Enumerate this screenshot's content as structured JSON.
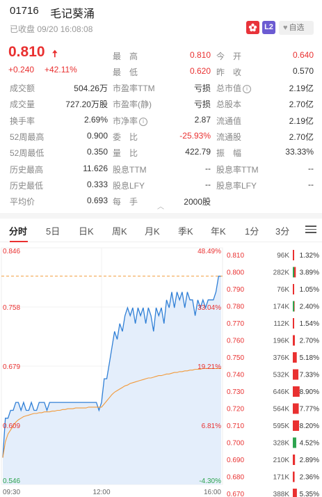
{
  "header": {
    "code": "01716",
    "name": "毛记葵涌",
    "status": "已收盘 09/20 16:08:08",
    "badge_lv": "L2",
    "favorite_label": "自选"
  },
  "quote": {
    "price": "0.810",
    "change": "+0.240",
    "change_pct": "+42.11%",
    "right_rows": [
      {
        "l1": "最　高",
        "v1": "0.810",
        "l2": "今　开",
        "v2": "0.640"
      },
      {
        "l1": "最　低",
        "v1": "0.620",
        "l2": "昨　收",
        "v2": "0.570"
      }
    ],
    "rows": [
      {
        "l1": "成交额",
        "v1": "504.26万",
        "l2": "市盈率TTM",
        "v2": "亏损",
        "l3": "总市值",
        "v3": "2.19亿"
      },
      {
        "l1": "成交量",
        "v1": "727.20万股",
        "l2": "市盈率(静)",
        "v2": "亏损",
        "l3": "总股本",
        "v3": "2.70亿"
      },
      {
        "l1": "换手率",
        "v1": "2.69%",
        "l2": "市净率",
        "v2": "2.87",
        "l3": "流通值",
        "v3": "2.19亿"
      },
      {
        "l1": "52周最高",
        "v1": "0.900",
        "l2": "委　比",
        "v2": "-25.93%",
        "l3": "流通股",
        "v3": "2.70亿"
      },
      {
        "l1": "52周最低",
        "v1": "0.350",
        "l2": "量　比",
        "v2": "422.79",
        "l3": "振　幅",
        "v3": "33.33%"
      },
      {
        "l1": "历史最高",
        "v1": "11.626",
        "l2": "股息TTM",
        "v2": "--",
        "l3": "股息率TTM",
        "v3": "--"
      },
      {
        "l1": "历史最低",
        "v1": "0.333",
        "l2": "股息LFY",
        "v2": "--",
        "l3": "股息率LFY",
        "v3": "--"
      },
      {
        "l1": "平均价",
        "v1": "0.693",
        "l2": "每　手",
        "v2": "2000股",
        "l3": "",
        "v3": ""
      }
    ]
  },
  "tabs": [
    "分时",
    "5日",
    "日K",
    "周K",
    "月K",
    "季K",
    "年K",
    "1分",
    "3分"
  ],
  "chart_data": {
    "type": "line",
    "title": "",
    "y_price_labels": [
      "0.846",
      "0.758",
      "0.679",
      "0.609",
      "0.546"
    ],
    "y_pct_labels": [
      "48.49%",
      "33.04%",
      "19.21%",
      "6.81%",
      "-4.30%"
    ],
    "x_labels": [
      "09:30",
      "12:00",
      "16:00"
    ],
    "ylim": [
      0.546,
      0.846
    ],
    "prev_close": 0.57,
    "series": [
      {
        "values": [
          0.58,
          0.63,
          0.63,
          0.64,
          0.64,
          0.65,
          0.65,
          0.64,
          0.65,
          0.64,
          0.64,
          0.65,
          0.64,
          0.64,
          0.65,
          0.65,
          0.65,
          0.64,
          0.65,
          0.65,
          0.65,
          0.65,
          0.65,
          0.65,
          0.65,
          0.65,
          0.65,
          0.65,
          0.65,
          0.65,
          0.65,
          0.65,
          0.65,
          0.65,
          0.65,
          0.65,
          0.65,
          0.64,
          0.65,
          0.68,
          0.68,
          0.7,
          0.72,
          0.74,
          0.73,
          0.75,
          0.74,
          0.76,
          0.77,
          0.76,
          0.77,
          0.75,
          0.77,
          0.76,
          0.77,
          0.75,
          0.77,
          0.76,
          0.74,
          0.77,
          0.76,
          0.77,
          0.75,
          0.78,
          0.77,
          0.79,
          0.77,
          0.79,
          0.78,
          0.79,
          0.77,
          0.79,
          0.78,
          0.78,
          0.76,
          0.78,
          0.77,
          0.78,
          0.77,
          0.78,
          0.78,
          0.78,
          0.79,
          0.81,
          0.81
        ]
      },
      {
        "values": [
          0.58,
          0.6,
          0.61,
          0.615,
          0.62,
          0.625,
          0.628,
          0.63,
          0.632,
          0.633,
          0.634,
          0.635,
          0.636,
          0.636,
          0.637,
          0.637,
          0.638,
          0.638,
          0.638,
          0.639,
          0.639,
          0.64,
          0.64,
          0.641,
          0.641,
          0.642,
          0.642,
          0.642,
          0.643,
          0.643,
          0.643,
          0.643,
          0.643,
          0.644,
          0.644,
          0.644,
          0.644,
          0.644,
          0.644,
          0.648,
          0.652,
          0.656,
          0.66,
          0.663,
          0.665,
          0.667,
          0.669,
          0.671,
          0.672,
          0.674,
          0.675,
          0.676,
          0.677,
          0.678,
          0.679,
          0.68,
          0.681,
          0.681,
          0.682,
          0.683,
          0.684,
          0.684,
          0.685,
          0.686,
          0.686,
          0.687,
          0.688,
          0.688,
          0.689,
          0.689,
          0.69,
          0.69,
          0.691,
          0.691,
          0.692,
          0.692,
          0.692,
          0.693,
          0.693,
          0.693,
          0.693,
          0.693,
          0.693,
          0.693,
          0.693
        ]
      }
    ],
    "current_price": 0.81
  },
  "order_book": {
    "rows": [
      {
        "price": "0.810",
        "vol": "96K",
        "pct": "1.32%",
        "dir": "sell",
        "ratio": 0.132
      },
      {
        "price": "0.800",
        "vol": "282K",
        "pct": "3.89%",
        "dir": "mixed",
        "ratio": 0.389
      },
      {
        "price": "0.790",
        "vol": "76K",
        "pct": "1.05%",
        "dir": "sell",
        "ratio": 0.105
      },
      {
        "price": "0.780",
        "vol": "174K",
        "pct": "2.40%",
        "dir": "mixed",
        "ratio": 0.24
      },
      {
        "price": "0.770",
        "vol": "112K",
        "pct": "1.54%",
        "dir": "sell",
        "ratio": 0.154
      },
      {
        "price": "0.760",
        "vol": "196K",
        "pct": "2.70%",
        "dir": "sell",
        "ratio": 0.27
      },
      {
        "price": "0.750",
        "vol": "376K",
        "pct": "5.18%",
        "dir": "sell",
        "ratio": 0.518
      },
      {
        "price": "0.740",
        "vol": "532K",
        "pct": "7.33%",
        "dir": "sell",
        "ratio": 0.733
      },
      {
        "price": "0.730",
        "vol": "646K",
        "pct": "8.90%",
        "dir": "sell",
        "ratio": 0.89
      },
      {
        "price": "0.720",
        "vol": "564K",
        "pct": "7.77%",
        "dir": "sell",
        "ratio": 0.777
      },
      {
        "price": "0.710",
        "vol": "595K",
        "pct": "8.20%",
        "dir": "sell",
        "ratio": 0.82
      },
      {
        "price": "0.700",
        "vol": "328K",
        "pct": "4.52%",
        "dir": "buy",
        "ratio": 0.452
      },
      {
        "price": "0.690",
        "vol": "210K",
        "pct": "2.89%",
        "dir": "sell",
        "ratio": 0.289
      },
      {
        "price": "0.680",
        "vol": "171K",
        "pct": "2.36%",
        "dir": "sell",
        "ratio": 0.236
      },
      {
        "price": "0.670",
        "vol": "388K",
        "pct": "5.35%",
        "dir": "sell",
        "ratio": 0.535
      }
    ]
  },
  "colors": {
    "up": "#e93030",
    "down": "#2ea44f",
    "price_line": "#2f7fd6",
    "avg_line": "#f29a3a",
    "area_fill": "#e4eefb"
  }
}
